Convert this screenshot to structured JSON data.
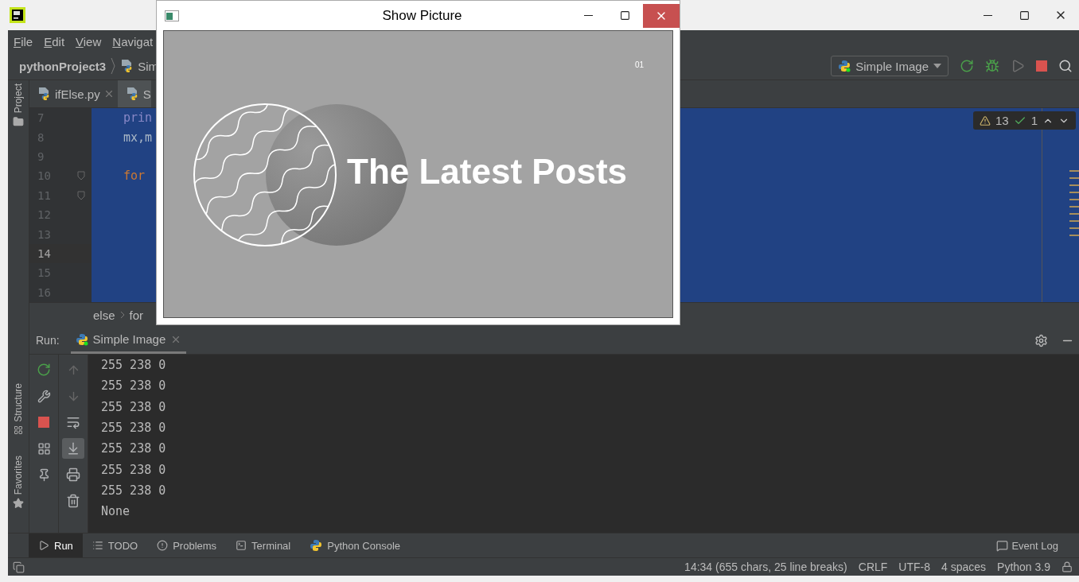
{
  "menu": [
    {
      "label": "File"
    },
    {
      "label": "Edit"
    },
    {
      "label": "View"
    },
    {
      "label": "Navigat"
    }
  ],
  "nav": {
    "project": "pythonProject3",
    "file": "Sim"
  },
  "run_config": {
    "label": "Simple Image"
  },
  "tool_strip": [
    {
      "label": "Project"
    },
    {
      "label": "Structure"
    },
    {
      "label": "Favorites"
    }
  ],
  "editor_tabs": [
    {
      "label": "ifElse.py",
      "selected": false
    },
    {
      "label": "S",
      "selected": true
    }
  ],
  "editor": {
    "lines": [
      {
        "number": "7",
        "code": "prin",
        "kind": "builtin",
        "fold": false,
        "current": false
      },
      {
        "number": "8",
        "code": "mx,m",
        "kind": "plain",
        "fold": false,
        "current": false
      },
      {
        "number": "9",
        "fold": false,
        "current": false
      },
      {
        "number": "10",
        "code": "for",
        "kind": "keyword",
        "fold": true,
        "current": false
      },
      {
        "number": "11",
        "fold": true,
        "current": false
      },
      {
        "number": "12",
        "fold": false,
        "current": false
      },
      {
        "number": "13",
        "fold": false,
        "current": false
      },
      {
        "number": "14",
        "fold": false,
        "current": true
      },
      {
        "number": "15",
        "fold": false,
        "current": false
      },
      {
        "number": "16",
        "fold": false,
        "current": false
      }
    ]
  },
  "inspections": {
    "warnings": "13",
    "typos": "1"
  },
  "breadcrumbs": [
    "else",
    "for"
  ],
  "run_panel": {
    "label": "Run:",
    "tab": "Simple Image",
    "output": [
      "255 238 0",
      "255 238 0",
      "255 238 0",
      "255 238 0",
      "255 238 0",
      "255 238 0",
      "255 238 0",
      "None"
    ]
  },
  "bottom_tabs": [
    {
      "label": "Run",
      "kind": "run",
      "selected": true
    },
    {
      "label": "TODO",
      "kind": "todo",
      "selected": false
    },
    {
      "label": "Problems",
      "kind": "problems",
      "selected": false
    },
    {
      "label": "Terminal",
      "kind": "terminal",
      "selected": false
    },
    {
      "label": "Python Console",
      "kind": "console",
      "selected": false
    }
  ],
  "event_log": "Event Log",
  "status": [
    "14:34 (655 chars, 25 line breaks)",
    "CRLF",
    "UTF-8",
    "4 spaces",
    "Python 3.9"
  ],
  "picture_window": {
    "title": "Show Picture",
    "image": {
      "number": "01",
      "headline": "The Latest Posts"
    }
  }
}
